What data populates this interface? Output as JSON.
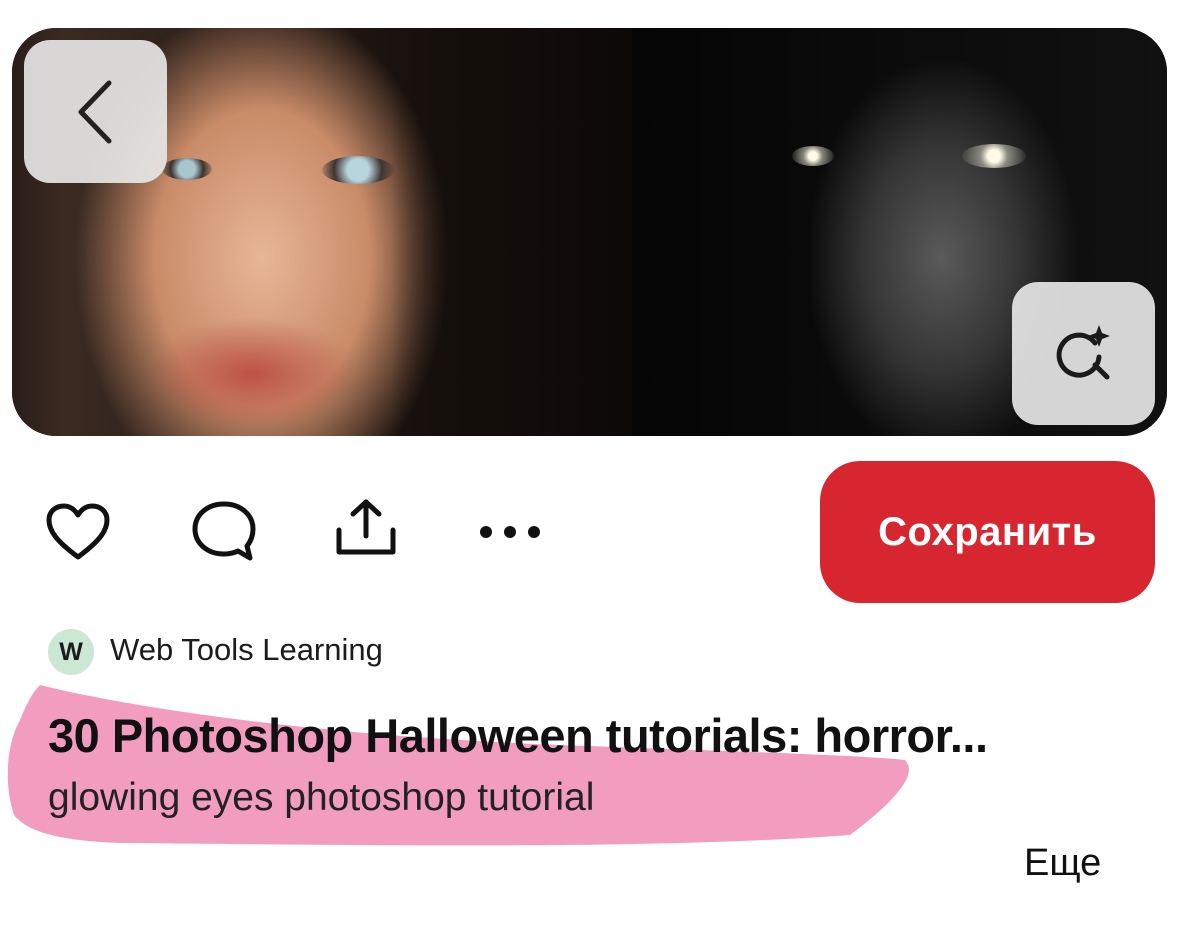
{
  "pin": {
    "image_alt": "",
    "back_icon": "chevron-left-icon",
    "visual_search_icon": "sparkle-search-icon"
  },
  "actions": {
    "like_icon": "heart-icon",
    "comment_icon": "comment-bubble-icon",
    "share_icon": "share-upload-icon",
    "more_icon": "more-dots-icon",
    "save_label": "Сохранить"
  },
  "author": {
    "avatar_initial": "W",
    "name": "Web Tools Learning"
  },
  "content": {
    "title": "30 Photoshop Halloween tutorials: horror...",
    "description": "glowing eyes photoshop tutorial",
    "more_label": "Еще"
  },
  "colors": {
    "save_button": "#d7262f",
    "avatar_bg": "#cbe8d4",
    "highlight": "#f08cb4"
  }
}
